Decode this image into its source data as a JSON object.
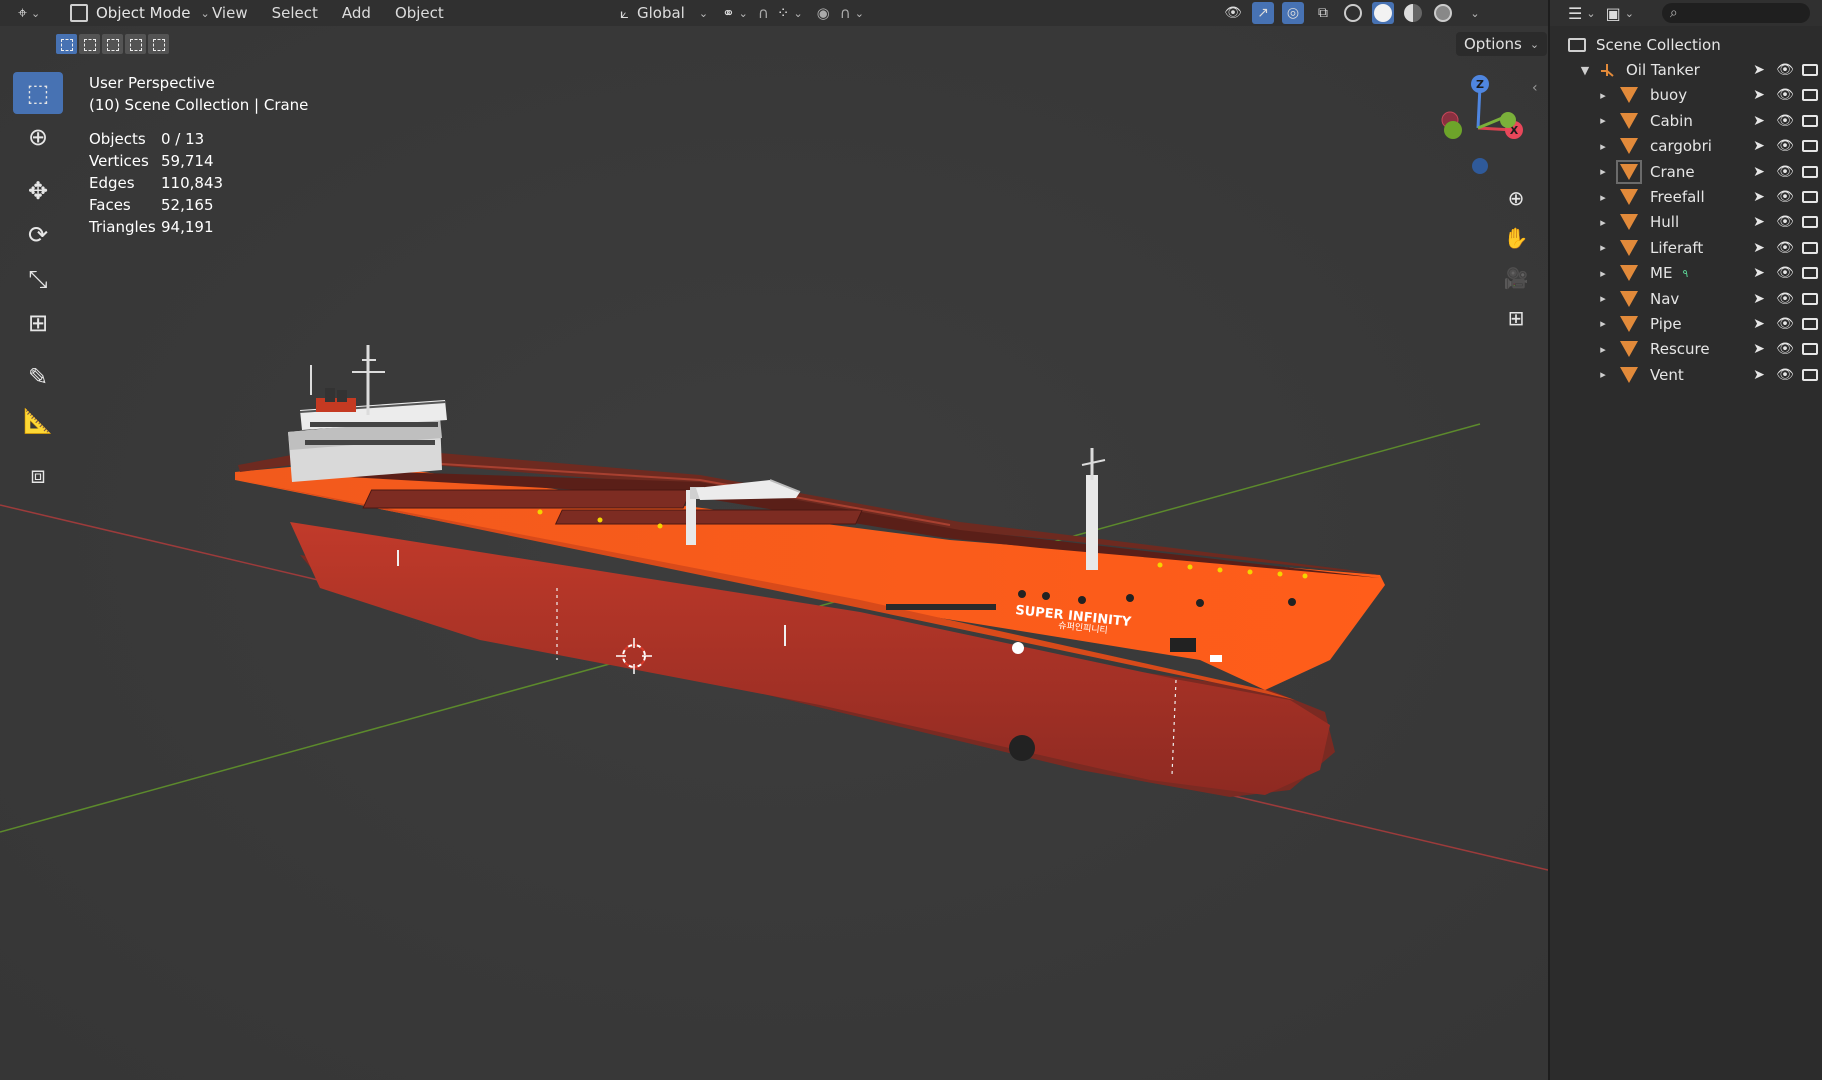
{
  "header": {
    "mode": "Object Mode",
    "menus": [
      "View",
      "Select",
      "Add",
      "Object"
    ],
    "transform_orientation": "Global"
  },
  "options_label": "Options",
  "stats": {
    "perspective": "User Perspective",
    "context": "(10) Scene Collection | Crane",
    "rows": [
      {
        "key": "Objects",
        "value": "0 / 13"
      },
      {
        "key": "Vertices",
        "value": "59,714"
      },
      {
        "key": "Edges",
        "value": "110,843"
      },
      {
        "key": "Faces",
        "value": "52,165"
      },
      {
        "key": "Triangles",
        "value": "94,191"
      }
    ]
  },
  "ship_text": {
    "name": "SUPER INFINITY",
    "subname": "슈퍼인피니티"
  },
  "gizmo": {
    "z": "Z",
    "x": "X"
  },
  "outliner": {
    "root": "Scene Collection",
    "parent": "Oil Tanker",
    "items": [
      "buoy",
      "Cabin",
      "cargobri",
      "Crane",
      "Freefall",
      "Hull",
      "Liferaft",
      "ME",
      "Nav",
      "Pipe",
      "Rescure",
      "Vent"
    ],
    "highlighted": "Crane"
  },
  "colors": {
    "accent": "#4772b3",
    "hull_orange": "#f0541c",
    "hull_red": "#b8372a",
    "mesh_icon": "#e28a3a"
  }
}
